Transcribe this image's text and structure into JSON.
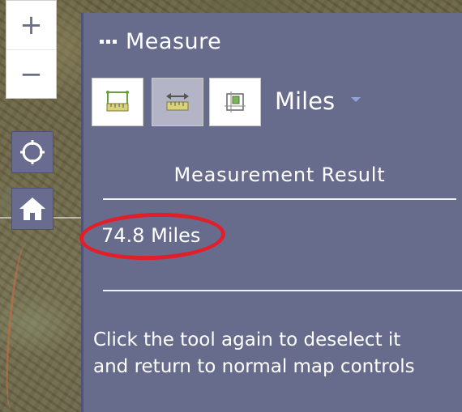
{
  "map_controls": {
    "zoom_in_label": "+",
    "zoom_out_label": "−",
    "locate_icon": "crosshair-circle-icon",
    "home_icon": "home-icon"
  },
  "measure": {
    "title": "Measure",
    "tools": [
      {
        "name": "area",
        "icon": "area-ruler-icon",
        "active": false
      },
      {
        "name": "distance",
        "icon": "distance-ruler-icon",
        "active": true
      },
      {
        "name": "location",
        "icon": "location-grid-icon",
        "active": false
      }
    ],
    "units_selected": "Miles",
    "result_heading": "Measurement Result",
    "result_value": "74.8 Miles",
    "help_line1": "Click the tool again to deselect it",
    "help_line2": "and return to normal map controls"
  },
  "colors": {
    "panel_bg": "#686c8c",
    "highlight_ring": "#e11f2a",
    "button_bg": "#6a6c8f"
  }
}
